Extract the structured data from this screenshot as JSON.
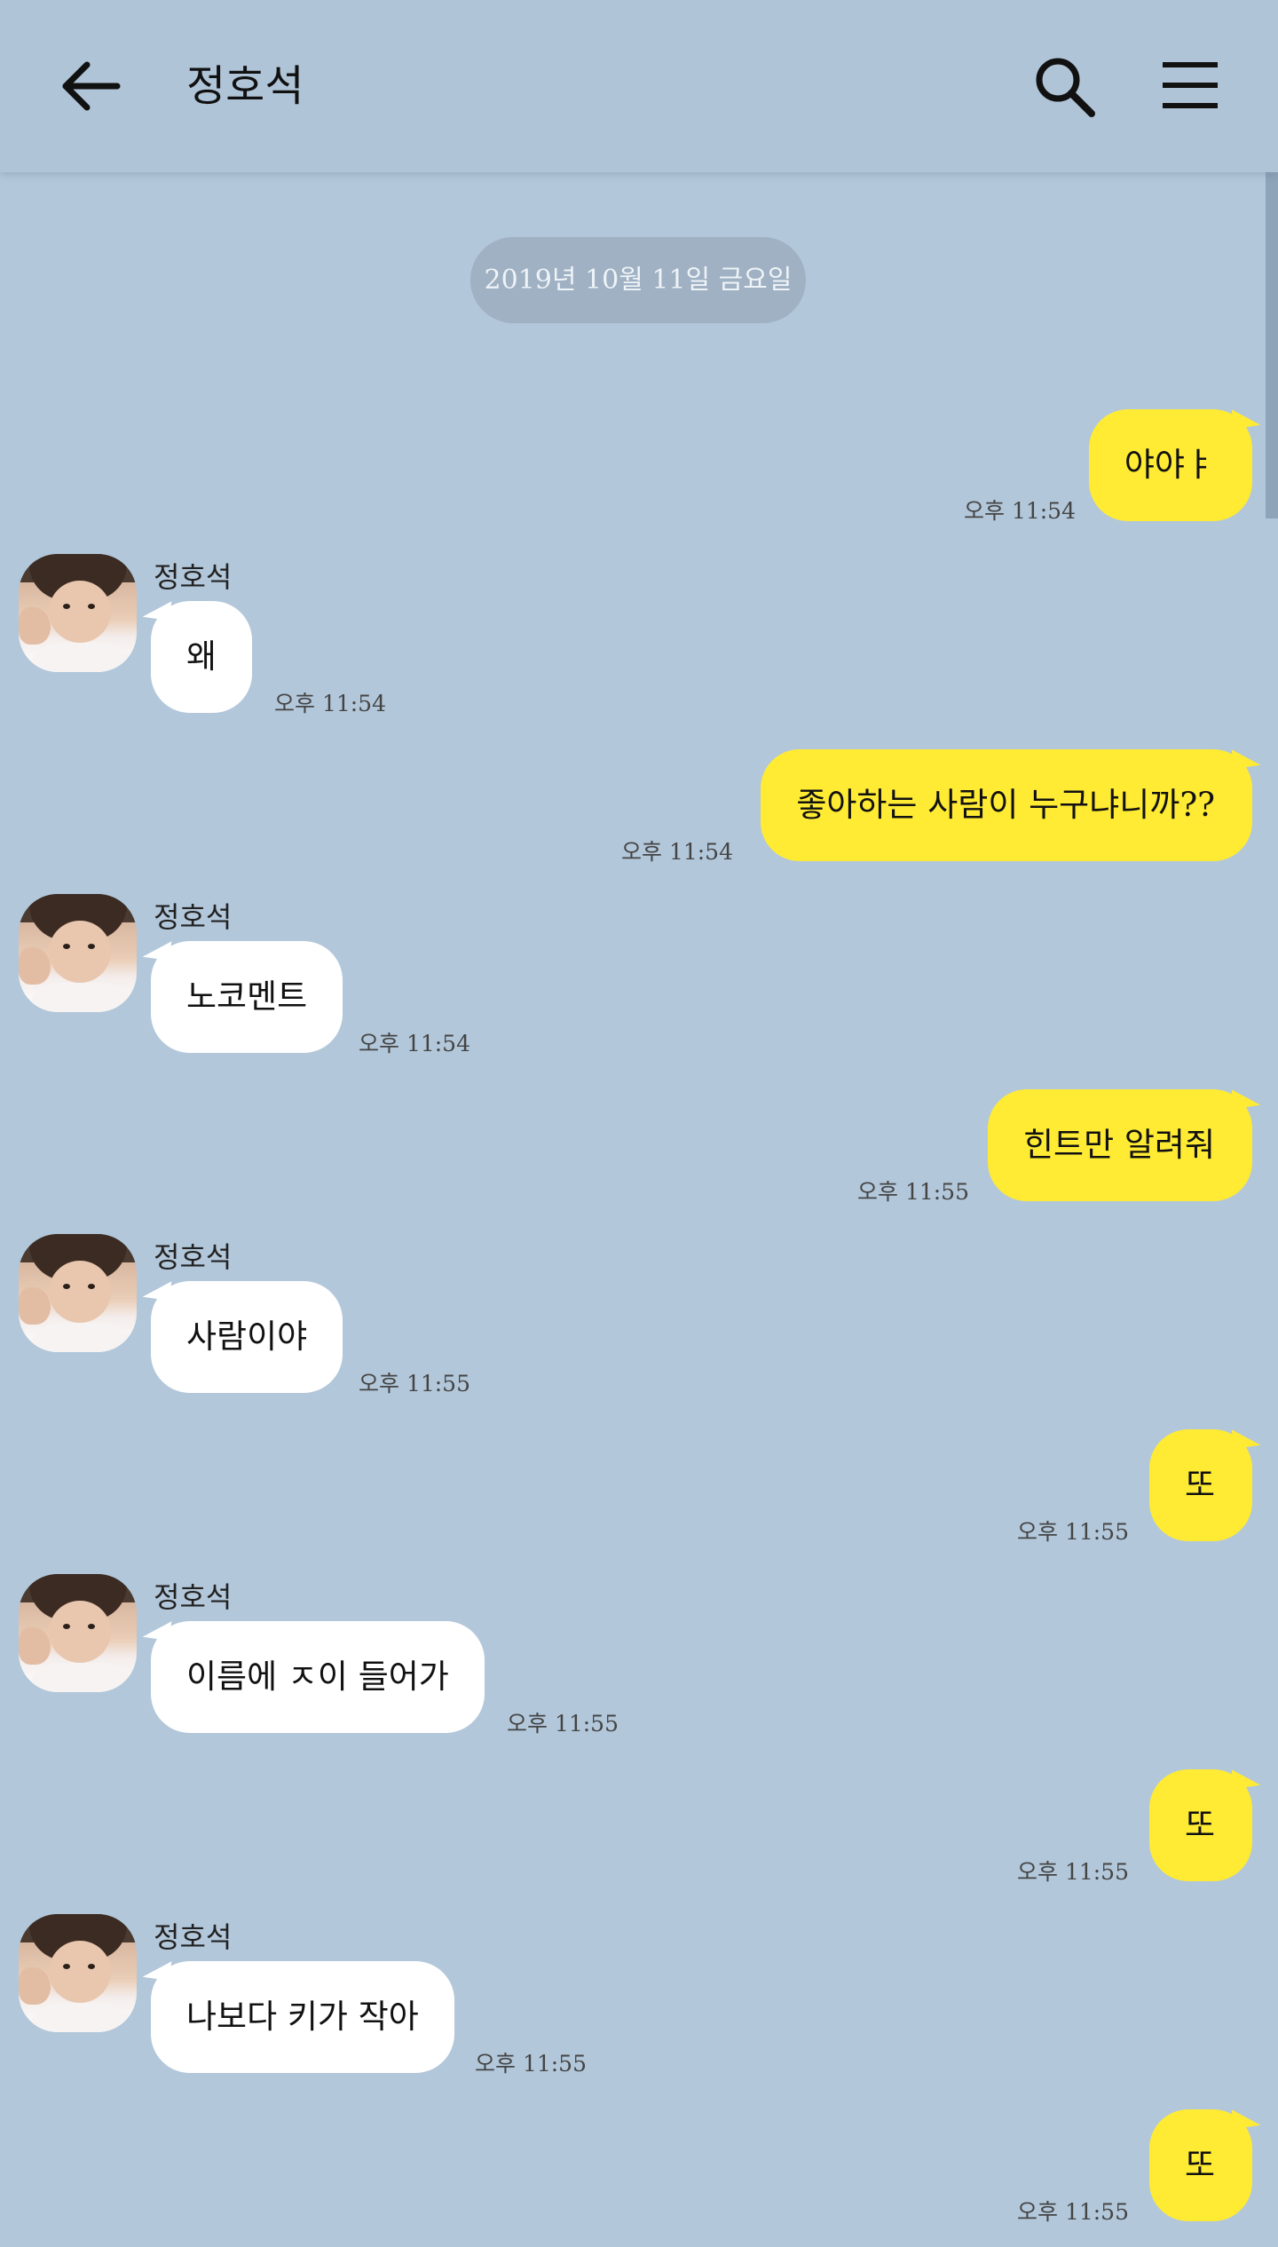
{
  "header": {
    "title": "정호석",
    "icons": {
      "back": "back-arrow-icon",
      "search": "search-icon",
      "menu": "hamburger-menu-icon"
    }
  },
  "date_divider": "2019년 10월 11일 금요일",
  "colors": {
    "background": "#b2c7da",
    "my_bubble": "#ffeb33",
    "their_bubble": "#ffffff",
    "date_pill": "#9fb1c3"
  },
  "messages": [
    {
      "from": "me",
      "text": "야야ㅑ",
      "time": "오후 11:54"
    },
    {
      "from": "them",
      "sender": "정호석",
      "text": "왜",
      "time": "오후 11:54"
    },
    {
      "from": "me",
      "text": "좋아하는 사람이 누구냐니까??",
      "time": "오후 11:54"
    },
    {
      "from": "them",
      "sender": "정호석",
      "text": "노코멘트",
      "time": "오후 11:54"
    },
    {
      "from": "me",
      "text": "힌트만 알려줘",
      "time": "오후 11:55"
    },
    {
      "from": "them",
      "sender": "정호석",
      "text": "사람이야",
      "time": "오후 11:55"
    },
    {
      "from": "me",
      "text": "또",
      "time": "오후 11:55"
    },
    {
      "from": "them",
      "sender": "정호석",
      "text": "이름에 ㅈ이 들어가",
      "time": "오후 11:55"
    },
    {
      "from": "me",
      "text": "또",
      "time": "오후 11:55"
    },
    {
      "from": "them",
      "sender": "정호석",
      "text": "나보다 키가 작아",
      "time": "오후 11:55"
    },
    {
      "from": "me",
      "text": "또",
      "time": "오후 11:55"
    }
  ]
}
